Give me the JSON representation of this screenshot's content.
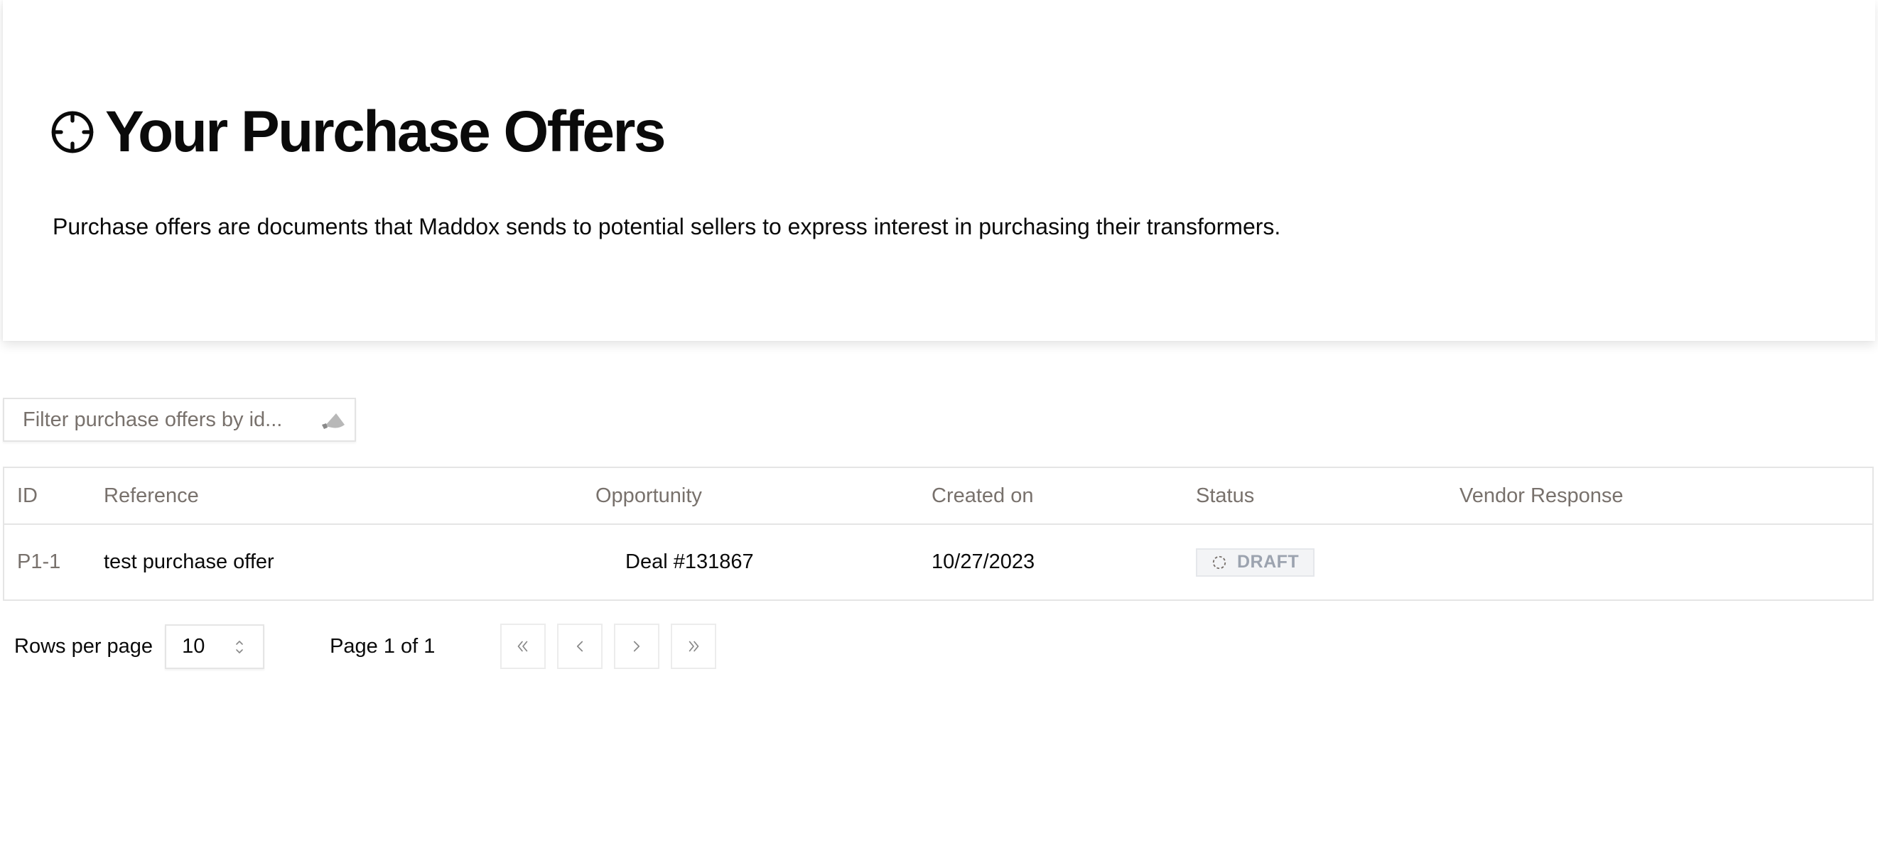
{
  "header": {
    "title": "Your Purchase Offers",
    "title_icon": "crosshair-icon",
    "description": "Purchase offers are documents that Maddox sends to potential sellers to express interest in purchasing their transformers."
  },
  "filter": {
    "placeholder": "Filter purchase offers by id...",
    "value": "",
    "icon": "spotlight-icon"
  },
  "table": {
    "columns": [
      "ID",
      "Reference",
      "Opportunity",
      "Created on",
      "Status",
      "Vendor Response"
    ],
    "rows": [
      {
        "id": "P1-1",
        "reference": "test purchase offer",
        "opportunity": "Deal #131867",
        "created_on": "10/27/2023",
        "status": "DRAFT",
        "status_icon": "dashed-circle-icon",
        "vendor_response": "",
        "actions_icon": "ellipsis-icon"
      }
    ]
  },
  "pagination": {
    "rows_per_page_label": "Rows per page",
    "rows_per_page_value": "10",
    "page_info": "Page 1 of 1",
    "buttons": [
      "first-page",
      "previous-page",
      "next-page",
      "last-page"
    ]
  },
  "colors": {
    "text_primary": "#0a0a0a",
    "text_muted": "#78716c",
    "border": "#e5e5e5",
    "status_draft_bg": "#f3f4f6",
    "status_draft_text": "#9ca3af"
  }
}
